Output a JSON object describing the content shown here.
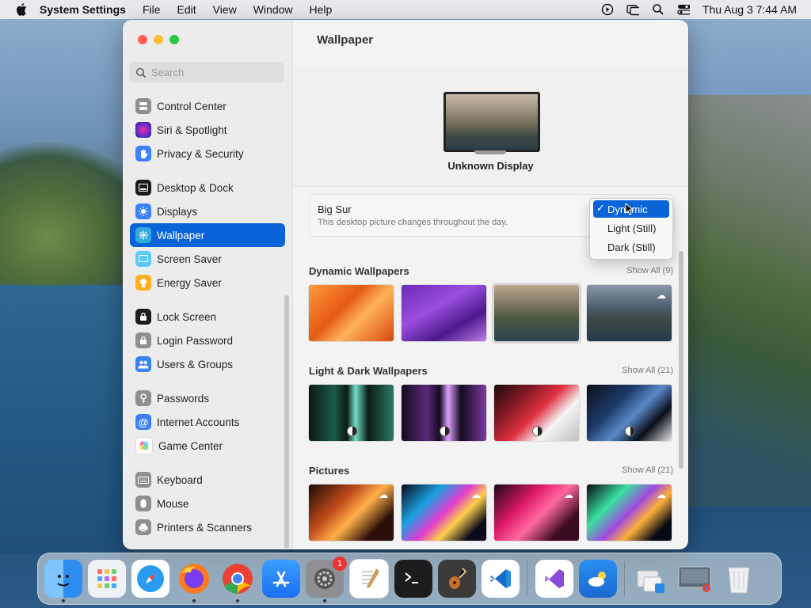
{
  "menubar": {
    "app_name": "System Settings",
    "items": [
      "File",
      "Edit",
      "View",
      "Window",
      "Help"
    ],
    "clock": "Thu Aug 3  7:44 AM"
  },
  "sidebar": {
    "search_placeholder": "Search",
    "items": [
      {
        "label": "Control Center",
        "icon": "control-center-icon",
        "color": "#8e8e93"
      },
      {
        "label": "Siri & Spotlight",
        "icon": "siri-icon",
        "color": "#7b3ad6"
      },
      {
        "label": "Privacy & Security",
        "icon": "hand-icon",
        "color": "#3d82f6"
      },
      {
        "label": "Desktop & Dock",
        "icon": "dock-icon",
        "color": "#1c1c1e"
      },
      {
        "label": "Displays",
        "icon": "sun-icon",
        "color": "#3b82f6"
      },
      {
        "label": "Wallpaper",
        "icon": "wallpaper-icon",
        "color": "#34aadc"
      },
      {
        "label": "Screen Saver",
        "icon": "screen-saver-icon",
        "color": "#5ac8fa"
      },
      {
        "label": "Energy Saver",
        "icon": "bulb-icon",
        "color": "#ffb020"
      },
      {
        "label": "Lock Screen",
        "icon": "lock-icon",
        "color": "#1c1c1e"
      },
      {
        "label": "Login Password",
        "icon": "password-lock-icon",
        "color": "#8e8e93"
      },
      {
        "label": "Users & Groups",
        "icon": "users-icon",
        "color": "#3b82f6"
      },
      {
        "label": "Passwords",
        "icon": "key-icon",
        "color": "#8e8e93"
      },
      {
        "label": "Internet Accounts",
        "icon": "at-icon",
        "color": "#3b82f6"
      },
      {
        "label": "Game Center",
        "icon": "game-center-icon",
        "color": "#ffffff"
      },
      {
        "label": "Keyboard",
        "icon": "keyboard-icon",
        "color": "#8e8e93"
      },
      {
        "label": "Mouse",
        "icon": "mouse-icon",
        "color": "#8e8e93"
      },
      {
        "label": "Printers & Scanners",
        "icon": "printer-icon",
        "color": "#8e8e93"
      }
    ]
  },
  "main": {
    "title": "Wallpaper",
    "display_name": "Unknown Display",
    "current": {
      "name": "Big Sur",
      "description": "This desktop picture changes throughout the day."
    },
    "popup": {
      "options": [
        "Dynamic",
        "Light (Still)",
        "Dark (Still)"
      ],
      "selected": "Dynamic",
      "check": "✓"
    },
    "sections": [
      {
        "title": "Dynamic Wallpapers",
        "show_all": "Show All (9)"
      },
      {
        "title": "Light & Dark Wallpapers",
        "show_all": "Show All (21)"
      },
      {
        "title": "Pictures",
        "show_all": "Show All (21)"
      }
    ]
  },
  "dock": {
    "apps": [
      "Finder",
      "Launchpad",
      "Safari",
      "Firefox",
      "Chrome",
      "App Store",
      "System Settings",
      "TextEdit",
      "Terminal",
      "Instruments",
      "VS Code",
      "Visual Studio",
      "Weather",
      "Folder Stack",
      "Screenshots",
      "Trash"
    ],
    "settings_badge": "1"
  },
  "colors": {
    "accent": "#0a64d8"
  }
}
